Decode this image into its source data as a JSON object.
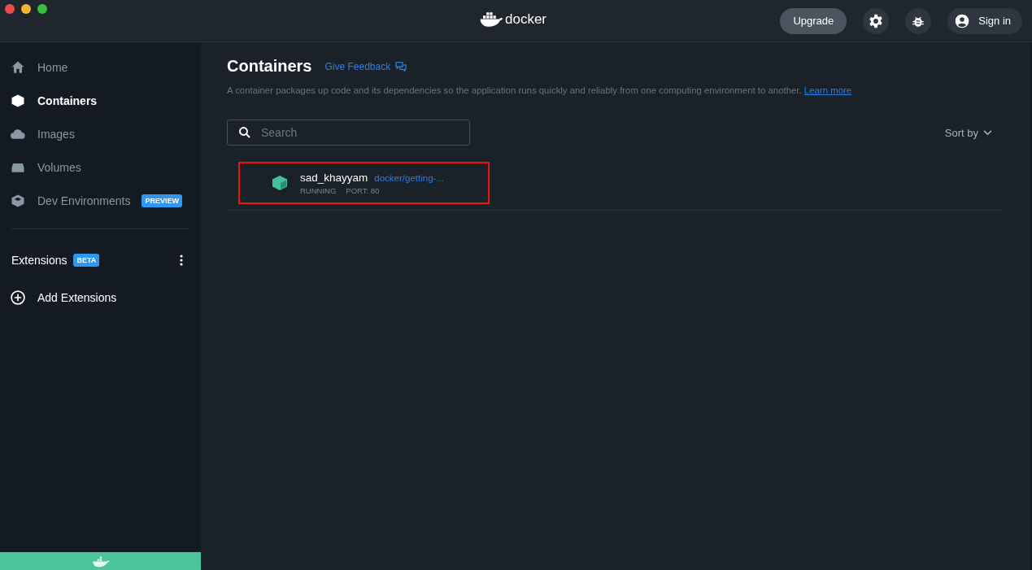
{
  "topbar": {
    "logo": "docker",
    "upgrade": "Upgrade",
    "sign_in": "Sign in"
  },
  "sidebar": {
    "items": [
      {
        "kind": "home",
        "label": "Home",
        "selected": false
      },
      {
        "kind": "containers",
        "label": "Containers",
        "selected": true
      },
      {
        "kind": "images",
        "label": "Images",
        "selected": false
      },
      {
        "kind": "volumes",
        "label": "Volumes",
        "selected": false
      },
      {
        "kind": "dev",
        "label": "Dev Environments",
        "badge": "PREVIEW",
        "selected": false
      }
    ],
    "extensions": {
      "label": "Extensions",
      "badge": "BETA"
    },
    "add_extensions": "Add Extensions"
  },
  "page": {
    "title": "Containers",
    "feedback": "Give Feedback",
    "description": "A container packages up code and its dependencies so the application runs quickly and reliably from one computing environment to another.",
    "learn_more": "Learn more",
    "search": {
      "placeholder": "Search"
    },
    "sort": "Sort by",
    "containers": [
      {
        "name": "sad_khayyam",
        "image": "docker/getting-...",
        "status": "RUNNING",
        "port": "PORT: 80",
        "highlighted": true
      }
    ]
  }
}
